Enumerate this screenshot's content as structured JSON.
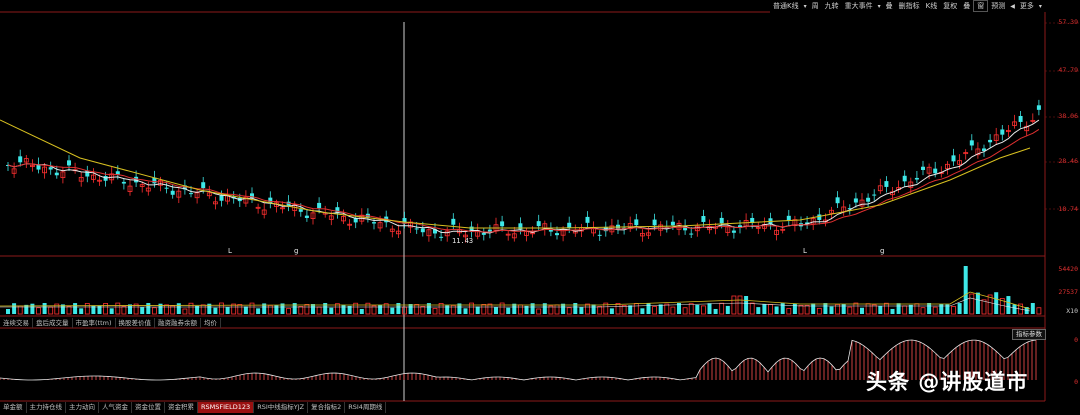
{
  "toolbar": {
    "items": [
      "普通K线",
      "周",
      "九转",
      "重大事件",
      "叠",
      "删指标",
      "K线",
      "复权",
      "叠",
      "窗",
      "预测",
      "更多"
    ]
  },
  "main_axis": [
    "57.39",
    "47.79",
    "38.06",
    "28.46",
    "18.74"
  ],
  "volume_axis": [
    "54420",
    "27537",
    "X10"
  ],
  "indicator_axis": [
    "0",
    "0"
  ],
  "markers": [
    "L",
    "g",
    "L",
    "g"
  ],
  "min_price_label": "11.43",
  "middle_tabs": [
    "连续交易",
    "盘后成交量",
    "市盈率(ttm)",
    "换股差价值",
    "融资融券余额",
    "均价"
  ],
  "bottom_tabs": [
    "单金额",
    "主力持仓线",
    "主力动向",
    "人气资金",
    "资金位置",
    "资金积累",
    "RSMSFIELD123",
    "RSI中线指标YJZ",
    "复合指标2",
    "RSI4周期线"
  ],
  "active_bottom_tab": "RSMSFIELD123",
  "param_button": "指标参数",
  "watermark": "头条 @讲股道市",
  "colors": {
    "up": "#ff3030",
    "down": "#3ee8e8",
    "ma_short": "#e8e8e8",
    "ma_mid": "#e03030",
    "ma_long": "#d8c020",
    "grid": "#8b1a1a"
  },
  "chart_data": {
    "type": "candlestick",
    "min_label_value": 11.43,
    "y_range": [
      11,
      58
    ]
  }
}
